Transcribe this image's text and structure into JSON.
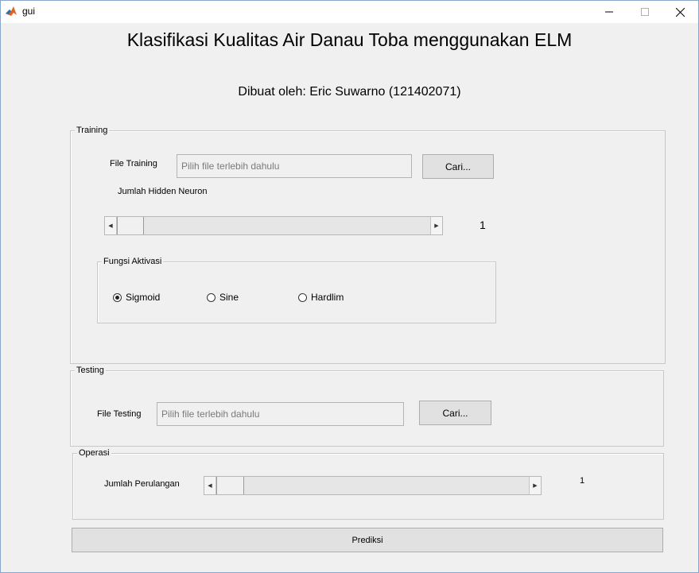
{
  "window": {
    "title": "gui",
    "minimize": "—",
    "maximize": "☐",
    "close": "✕"
  },
  "header": {
    "title": "Klasifikasi Kualitas Air Danau Toba menggunakan ELM",
    "subtitle": "Dibuat oleh: Eric Suwarno (121402071)"
  },
  "training": {
    "panel_title": "Training",
    "file_label": "File Training",
    "file_placeholder": "Pilih file terlebih dahulu",
    "browse_label": "Cari...",
    "hidden_neuron_label": "Jumlah Hidden Neuron",
    "hidden_neuron_value": "1",
    "activation": {
      "panel_title": "Fungsi Aktivasi",
      "options": [
        {
          "label": "Sigmoid",
          "selected": true
        },
        {
          "label": "Sine",
          "selected": false
        },
        {
          "label": "Hardlim",
          "selected": false
        }
      ]
    }
  },
  "testing": {
    "panel_title": "Testing",
    "file_label": "File Testing",
    "file_placeholder": "Pilih file terlebih dahulu",
    "browse_label": "Cari..."
  },
  "operasi": {
    "panel_title": "Operasi",
    "iteration_label": "Jumlah Perulangan",
    "iteration_value": "1"
  },
  "predict_label": "Prediksi"
}
